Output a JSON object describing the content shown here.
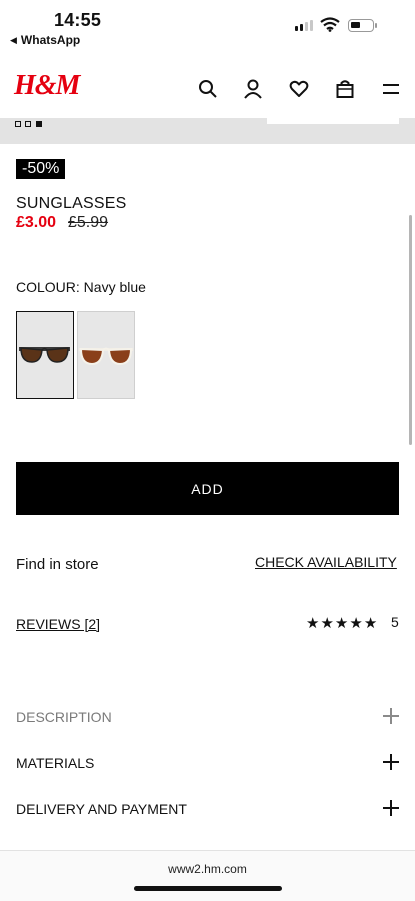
{
  "status_bar": {
    "time": "14:55",
    "back_app": "WhatsApp"
  },
  "brand": {
    "logo": "H&M",
    "color": "#e50010"
  },
  "header": {
    "icons": [
      "search-icon",
      "account-icon",
      "heart-icon",
      "bag-icon",
      "menu-icon"
    ]
  },
  "gallery": {
    "dots": 3,
    "active_dot": 3
  },
  "product": {
    "discount": "-50%",
    "name": "SUNGLASSES",
    "price": "£3.00",
    "old_price": "£5.99",
    "colour_label": "COLOUR: Navy blue"
  },
  "actions": {
    "add_label": "ADD"
  },
  "store": {
    "find_label": "Find in store",
    "check_label": "CHECK AVAILABILITY"
  },
  "reviews": {
    "label": "REVIEWS [2]",
    "rating": "5",
    "stars": 5
  },
  "accordions": [
    {
      "label": "DESCRIPTION"
    },
    {
      "label": "MATERIALS"
    },
    {
      "label": "DELIVERY AND PAYMENT"
    }
  ],
  "browser": {
    "url": "www2.hm.com"
  }
}
